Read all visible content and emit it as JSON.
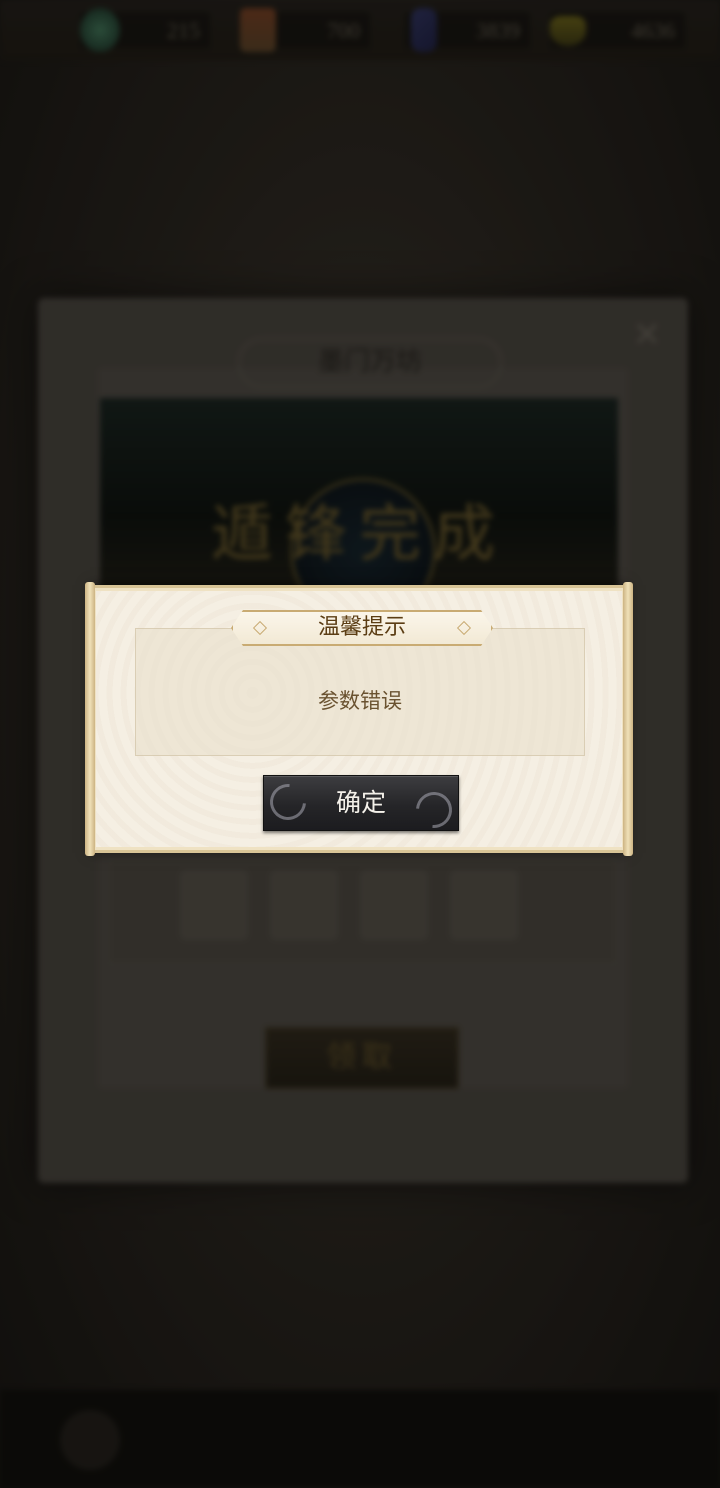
{
  "resources": [
    {
      "icon": "jade-icon",
      "value": "215"
    },
    {
      "icon": "scroll-token-icon",
      "value": "700"
    },
    {
      "icon": "purple-crystal-icon",
      "value": "3839"
    },
    {
      "icon": "gold-ingot-icon",
      "value": "4636"
    }
  ],
  "background_panel": {
    "title": "墨门万坊",
    "banner_text": "遁锋完成",
    "claim_label": "领取"
  },
  "dialog": {
    "title": "温馨提示",
    "message": "参数错误",
    "confirm_label": "确定"
  }
}
